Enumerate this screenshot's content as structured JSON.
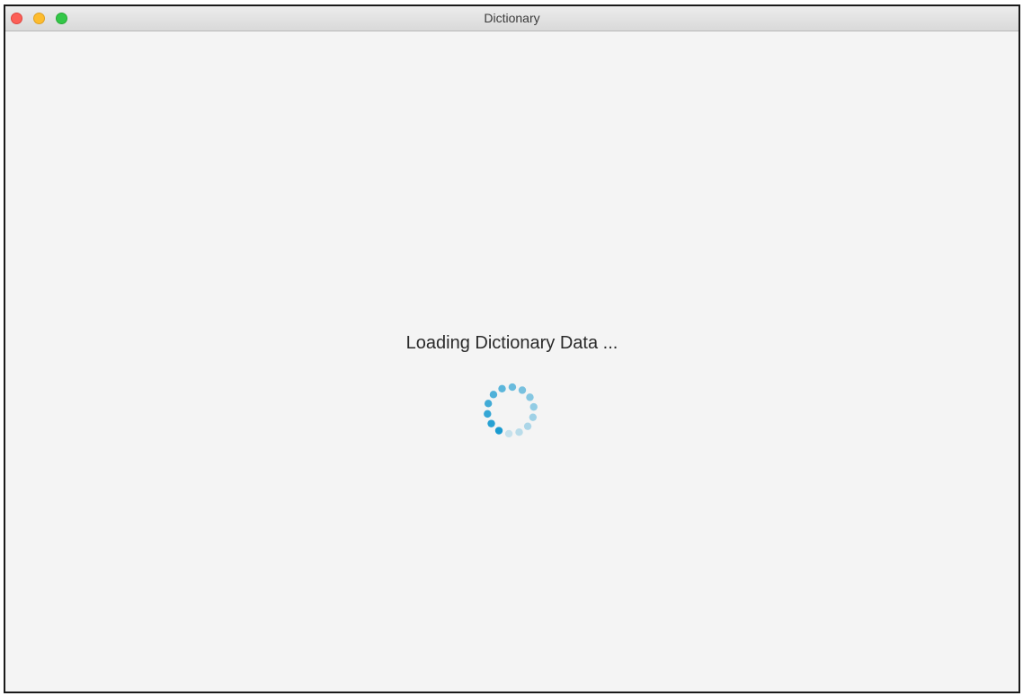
{
  "window": {
    "title": "Dictionary"
  },
  "main": {
    "loading_text": "Loading Dictionary Data ..."
  },
  "spinner": {
    "icon": "loading-spinner-icon",
    "color": "#1a9bd0"
  }
}
